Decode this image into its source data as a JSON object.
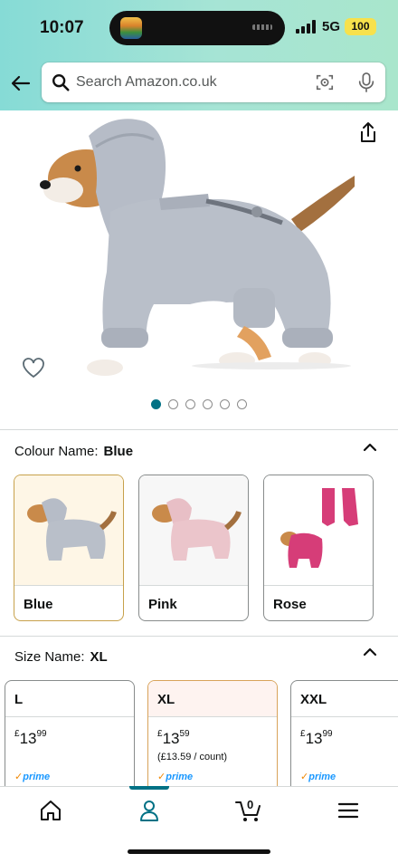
{
  "status_bar": {
    "time": "10:07",
    "network": "5G",
    "battery": "100"
  },
  "search": {
    "placeholder": "Search Amazon.co.uk"
  },
  "product": {
    "image_count": 6,
    "active_image_index": 0
  },
  "colour": {
    "label": "Colour Name:",
    "selected": "Blue",
    "options": [
      "Blue",
      "Pink",
      "Rose"
    ]
  },
  "size": {
    "label": "Size Name:",
    "selected": "XL",
    "options": [
      {
        "name": "L",
        "currency": "£",
        "whole": "13",
        "fraction": "99",
        "unit_price": "",
        "prime": "prime"
      },
      {
        "name": "XL",
        "currency": "£",
        "whole": "13",
        "fraction": "59",
        "unit_price": "(£13.59 / count)",
        "prime": "prime"
      },
      {
        "name": "XXL",
        "currency": "£",
        "whole": "13",
        "fraction": "99",
        "unit_price": "",
        "prime": "prime"
      }
    ]
  },
  "tabbar": {
    "cart_count": "0",
    "active_tab": "account"
  },
  "colors": {
    "accent": "#007185",
    "header_gradient_start": "#86dbd6",
    "header_gradient_end": "#a9e6cc",
    "selected_border": "#c7a14b",
    "prime_blue": "#1a98ff"
  }
}
